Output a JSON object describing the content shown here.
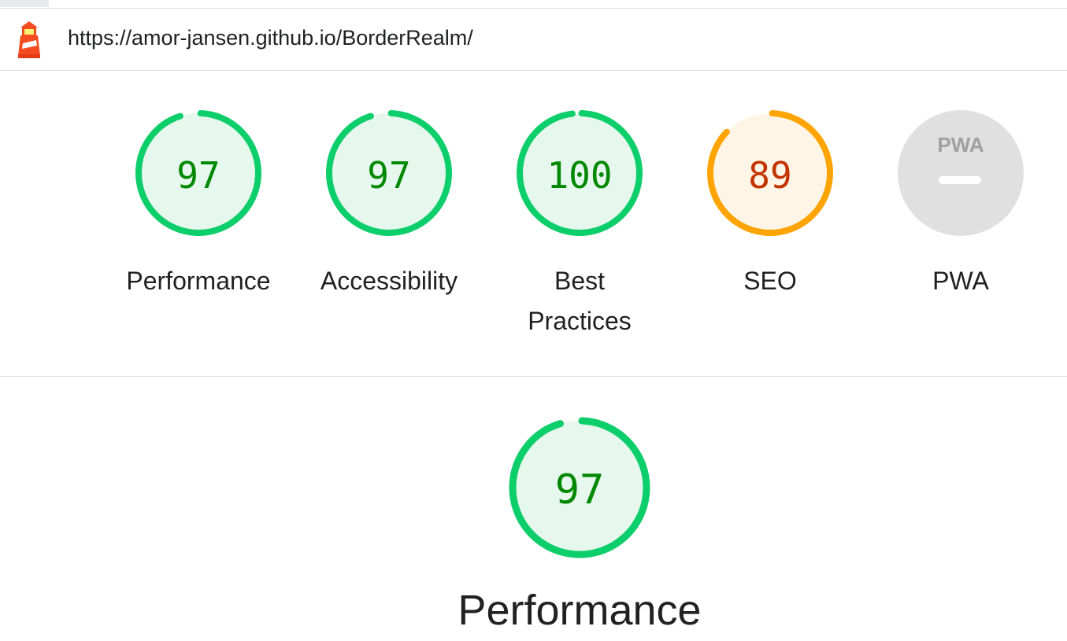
{
  "url": "https://amor-jansen.github.io/BorderRealm/",
  "colors": {
    "pass": "#0cce6b",
    "pass_fill": "#e6f7ed",
    "pass_text": "#008800",
    "average": "#ffa400",
    "average_fill": "#fff5e6",
    "average_text": "#c33300",
    "na": "#e0e0e0"
  },
  "categories": [
    {
      "label": "Performance",
      "score": "97",
      "value": 0.97,
      "status": "pass"
    },
    {
      "label": "Accessibility",
      "score": "97",
      "value": 0.97,
      "status": "pass"
    },
    {
      "label": "Best\nPractices",
      "label_line1": "Best",
      "label_line2": "Practices",
      "score": "100",
      "value": 1.0,
      "status": "pass"
    },
    {
      "label": "SEO",
      "score": "89",
      "value": 0.89,
      "status": "average"
    },
    {
      "label": "PWA",
      "badge": "PWA",
      "status": "na"
    }
  ],
  "performance_section": {
    "title": "Performance",
    "score": "97",
    "value": 0.97
  }
}
